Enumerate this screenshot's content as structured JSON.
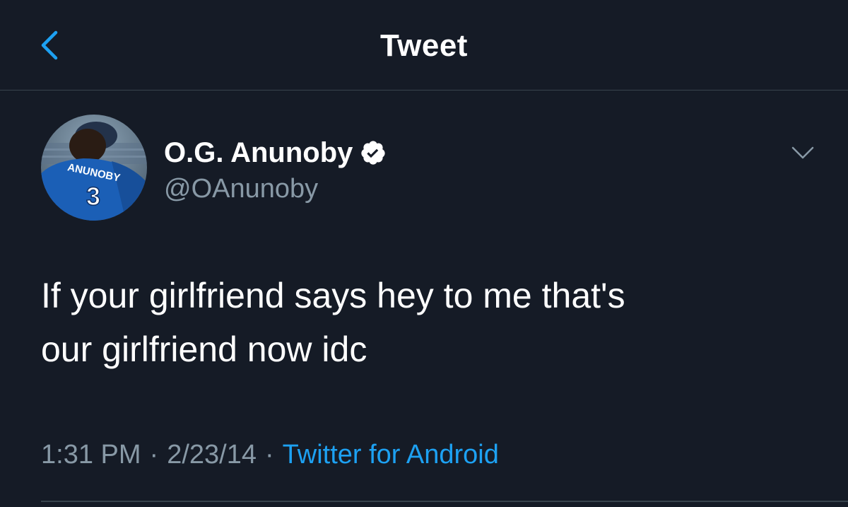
{
  "header": {
    "title": "Tweet",
    "back_icon": "chevron-left-icon"
  },
  "author": {
    "display_name": "O.G. Anunoby",
    "handle": "@OAnunoby",
    "verified_icon": "verified-badge-icon",
    "avatar_jersey_name": "ANUNOBY",
    "avatar_jersey_number": "3"
  },
  "tweet": {
    "text": "If your girlfriend says hey to me that's\nour girlfriend now idc",
    "time": "1:31 PM",
    "separator": "·",
    "date": "2/23/14",
    "source": "Twitter for Android"
  },
  "colors": {
    "background": "#151b26",
    "accent": "#1da1f2",
    "secondary_text": "#8899a6",
    "divider": "#38444d"
  }
}
